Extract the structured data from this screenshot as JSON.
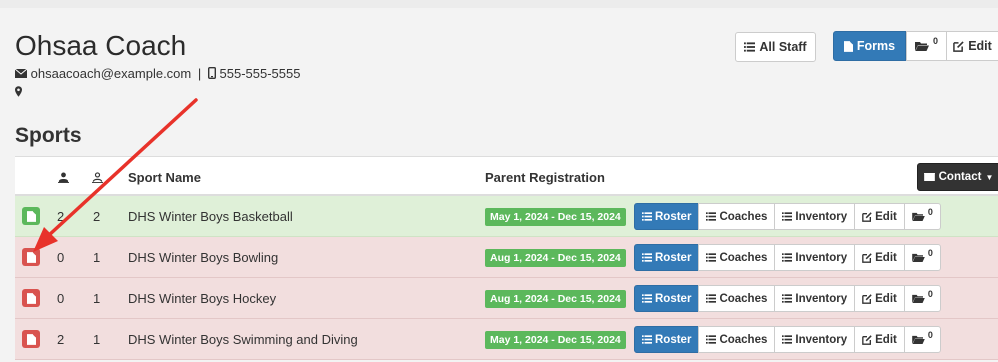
{
  "profile": {
    "name": "Ohsaa Coach",
    "email": "ohsaacoach@example.com",
    "separator": "|",
    "phone": "555-555-5555"
  },
  "toolbar": {
    "all_staff_label": "All Staff",
    "forms_label": "Forms",
    "folder_count": "0",
    "edit_label": "Edit"
  },
  "section": {
    "title": "Sports"
  },
  "table": {
    "headers": {
      "sport_name": "Sport Name",
      "parent_registration": "Parent Registration"
    },
    "contact_label": "Contact",
    "action_labels": {
      "roster": "Roster",
      "coaches": "Coaches",
      "inventory": "Inventory",
      "edit": "Edit"
    },
    "rows": [
      {
        "status": "green",
        "col1": "2",
        "col2": "2",
        "name": "DHS Winter Boys Basketball",
        "registration": "May 1, 2024 - Dec 15, 2024",
        "folder_count": "0"
      },
      {
        "status": "red",
        "col1": "0",
        "col2": "1",
        "name": "DHS Winter Boys Bowling",
        "registration": "Aug 1, 2024 - Dec 15, 2024",
        "folder_count": "0"
      },
      {
        "status": "red",
        "col1": "0",
        "col2": "1",
        "name": "DHS Winter Boys Hockey",
        "registration": "Aug 1, 2024 - Dec 15, 2024",
        "folder_count": "0"
      },
      {
        "status": "red",
        "col1": "2",
        "col2": "1",
        "name": "DHS Winter Boys Swimming and Diving",
        "registration": "May 1, 2024 - Dec 15, 2024",
        "folder_count": "0"
      }
    ]
  },
  "colors": {
    "primary": "#337ab7",
    "success": "#5cb85c",
    "danger": "#d9534f",
    "row_success": "#dff0d8",
    "row_danger": "#f2dede",
    "annotation_arrow": "#e8322a"
  }
}
